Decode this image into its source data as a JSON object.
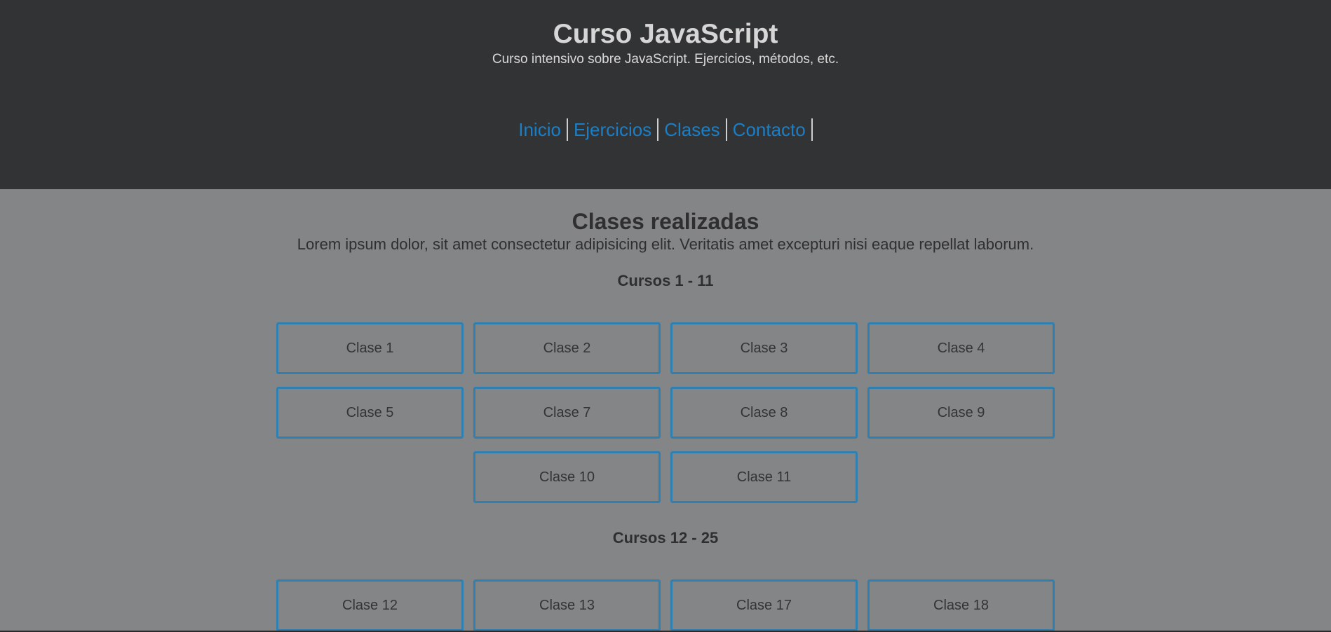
{
  "header": {
    "title": "Curso JavaScript",
    "subtitle": "Curso intensivo sobre JavaScript. Ejercicios, métodos, etc."
  },
  "nav": {
    "items": [
      "Inicio",
      "Ejercicios",
      "Clases",
      "Contacto"
    ]
  },
  "main": {
    "title": "Clases realizadas",
    "description": "Lorem ipsum dolor, sit amet consectetur adipisicing elit. Veritatis amet excepturi nisi eaque repellat laborum.",
    "groups": [
      {
        "title": "Cursos 1 - 11",
        "classes": [
          "Clase 1",
          "Clase 2",
          "Clase 3",
          "Clase 4",
          "Clase 5",
          "Clase 7",
          "Clase 8",
          "Clase 9",
          "Clase 10",
          "Clase 11"
        ]
      },
      {
        "title": "Cursos 12 - 25",
        "classes": [
          "Clase 12",
          "Clase 13",
          "Clase 17",
          "Clase 18"
        ]
      }
    ]
  },
  "colors": {
    "header_bg": "#323335",
    "body_bg": "#848586",
    "link": "#1a7fc6",
    "card_border": "#2f7fb0"
  }
}
